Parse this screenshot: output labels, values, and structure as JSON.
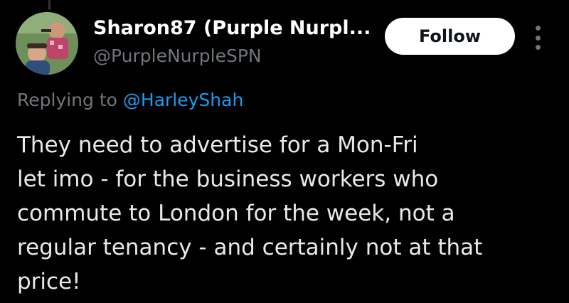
{
  "author": {
    "display_name": "Sharon87 (Purple Nurpl...",
    "handle": "@PurpleNurpleSPN",
    "avatar_icon": "profile-photo"
  },
  "follow_label": "Follow",
  "more_icon": "more-options-icon",
  "reply": {
    "prefix": "Replying to ",
    "target": "@HarleyShah"
  },
  "tweet_lines": [
    "They need to advertise for a Mon-Fri",
    "let imo - for the business workers who",
    "commute to London for the week, not a",
    "regular tenancy - and certainly not at that",
    "price!"
  ],
  "colors": {
    "background": "#000000",
    "text": "#e7e9ea",
    "secondary_text": "#71767b",
    "link": "#1d9bf0",
    "follow_bg": "#ffffff"
  }
}
